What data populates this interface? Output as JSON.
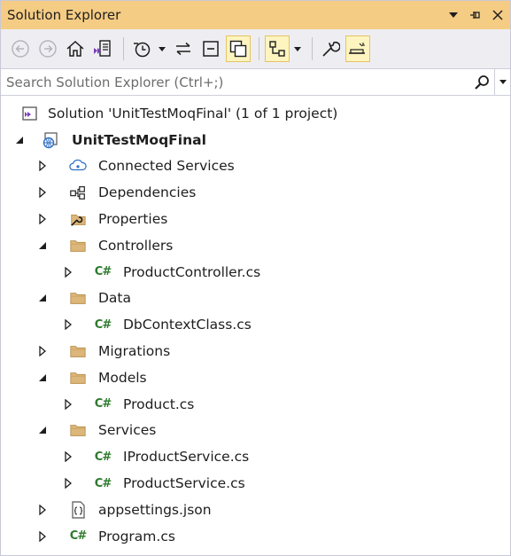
{
  "window": {
    "title": "Solution Explorer",
    "title_buttons": [
      "▾",
      "⊣",
      "✕"
    ]
  },
  "search": {
    "placeholder": "Search Solution Explorer (Ctrl+;)"
  },
  "solution": {
    "label": "Solution 'UnitTestMoqFinal' (1 of 1 project)"
  },
  "project": {
    "label": "UnitTestMoqFinal"
  },
  "tree": {
    "connected_services": "Connected Services",
    "dependencies": "Dependencies",
    "properties": "Properties",
    "controllers": "Controllers",
    "product_controller": "ProductController.cs",
    "data": "Data",
    "db_context": "DbContextClass.cs",
    "migrations": "Migrations",
    "models": "Models",
    "product": "Product.cs",
    "services": "Services",
    "iproduct_service": "IProductService.cs",
    "product_service": "ProductService.cs",
    "appsettings": "appsettings.json",
    "program": "Program.cs"
  },
  "csharp_badge": "C#",
  "colors": {
    "title_bar": "#f5cc84",
    "toolbar": "#eeeef2",
    "folder": "#dcb67a",
    "csharp": "#2d7a2d",
    "active_tool": "#fdf4bf"
  },
  "icons": {
    "back": "back-arrow-icon",
    "forward": "forward-arrow-icon",
    "home": "home-icon",
    "switch_views": "switch-views-icon",
    "pending_changes": "clock-icon",
    "sync": "sync-icon",
    "collapse_all": "collapse-all-icon",
    "show_all_files": "show-all-files-icon",
    "view_class_diagram": "class-diagram-icon",
    "properties": "wrench-icon",
    "preview": "preview-icon",
    "search": "search-icon"
  }
}
